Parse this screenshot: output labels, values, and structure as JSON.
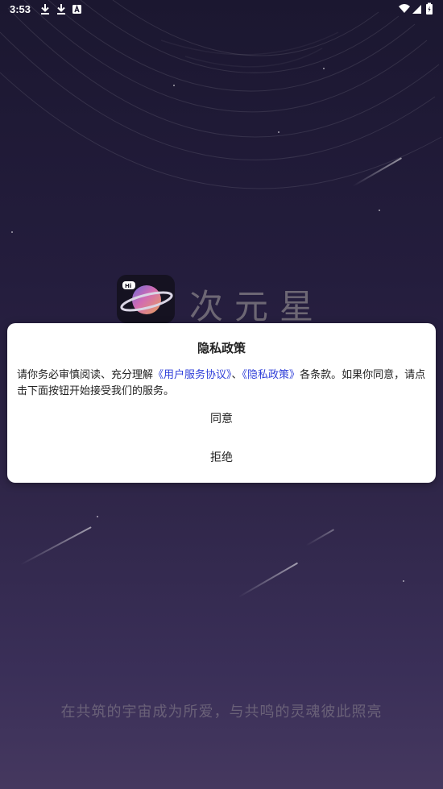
{
  "status_bar": {
    "time": "3:53",
    "left_icons": [
      "download-icon",
      "download-icon",
      "font-icon"
    ],
    "right_icons": [
      "wifi-icon",
      "cell-signal-icon",
      "battery-icon"
    ]
  },
  "logo": {
    "name": "次元星",
    "icon": "planet-icon"
  },
  "dialog": {
    "title": "隐私政策",
    "body_prefix": "请你务必审慎阅读、充分理解",
    "link_user_agreement": "《用户服务协议》",
    "separator": "、",
    "link_privacy_policy": "《隐私政策》",
    "body_suffix": "各条款。如果你同意，请点击下面按钮开始接受我们的服务。",
    "agree_label": "同意",
    "refuse_label": "拒绝"
  },
  "slogan": "在共筑的宇宙成为所爱，与共鸣的灵魂彼此照亮",
  "colors": {
    "background_top": "#1b1730",
    "background_bottom": "#45385f",
    "dialog_background": "#ffffff",
    "link": "#2f3fd9",
    "text": "#222222"
  }
}
